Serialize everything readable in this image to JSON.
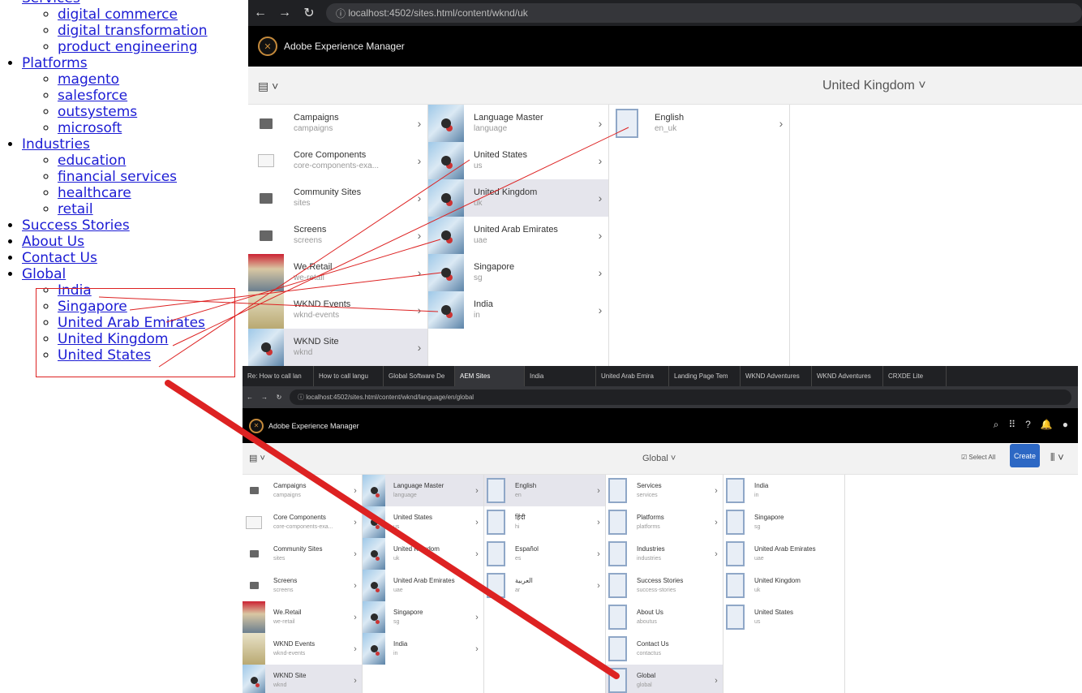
{
  "nav": {
    "items": [
      {
        "label": "Services",
        "children": [
          "digital commerce",
          "digital transformation",
          "product engineering"
        ]
      },
      {
        "label": "Platforms",
        "children": [
          "magento",
          "salesforce",
          "outsystems",
          "microsoft"
        ]
      },
      {
        "label": "Industries",
        "children": [
          "education",
          "financial services",
          "healthcare",
          "retail"
        ]
      },
      {
        "label": "Success Stories",
        "children": []
      },
      {
        "label": "About Us",
        "children": []
      },
      {
        "label": "Contact Us",
        "children": []
      },
      {
        "label": "Global",
        "children": [
          "India",
          "Singapore",
          "United Arab Emirates",
          "United Kingdom",
          "United States"
        ]
      }
    ]
  },
  "screen1": {
    "url": "localhost:4502/sites.html/content/wknd/uk",
    "app_title": "Adobe Experience Manager",
    "location_title": "United Kingdom",
    "columns": [
      [
        {
          "title": "Campaigns",
          "sub": "campaigns",
          "thumb": "folder"
        },
        {
          "title": "Core Components",
          "sub": "core-components-exa...",
          "thumb": "comp"
        },
        {
          "title": "Community Sites",
          "sub": "sites",
          "thumb": "folder"
        },
        {
          "title": "Screens",
          "sub": "screens",
          "thumb": "folder"
        },
        {
          "title": "We.Retail",
          "sub": "we-retail",
          "thumb": "photo"
        },
        {
          "title": "WKND Events",
          "sub": "wknd-events",
          "thumb": "photo2"
        },
        {
          "title": "WKND Site",
          "sub": "wknd",
          "thumb": "img",
          "selected": true
        }
      ],
      [
        {
          "title": "Language Master",
          "sub": "language",
          "thumb": "img"
        },
        {
          "title": "United States",
          "sub": "us",
          "thumb": "img"
        },
        {
          "title": "United Kingdom",
          "sub": "uk",
          "thumb": "img",
          "selected": true
        },
        {
          "title": "United Arab Emirates",
          "sub": "uae",
          "thumb": "img"
        },
        {
          "title": "Singapore",
          "sub": "sg",
          "thumb": "img"
        },
        {
          "title": "India",
          "sub": "in",
          "thumb": "img"
        }
      ],
      [
        {
          "title": "English",
          "sub": "en_uk",
          "thumb": "page"
        }
      ]
    ]
  },
  "screen2": {
    "tabs": [
      "Re: How to call lan",
      "How to call langu",
      "Global Software De",
      "AEM Sites",
      "India",
      "United Arab Emira",
      "Landing Page Tem",
      "WKND Adventures",
      "WKND Adventures",
      "CRXDE Lite"
    ],
    "url": "localhost:4502/sites.html/content/wknd/language/en/global",
    "app_title": "Adobe Experience Manager",
    "location_title": "Global",
    "select_all": "Select All",
    "create": "Create",
    "columns": [
      [
        {
          "title": "Campaigns",
          "sub": "campaigns",
          "thumb": "folder"
        },
        {
          "title": "Core Components",
          "sub": "core-components-exa...",
          "thumb": "comp"
        },
        {
          "title": "Community Sites",
          "sub": "sites",
          "thumb": "folder"
        },
        {
          "title": "Screens",
          "sub": "screens",
          "thumb": "folder"
        },
        {
          "title": "We.Retail",
          "sub": "we-retail",
          "thumb": "photo"
        },
        {
          "title": "WKND Events",
          "sub": "wknd-events",
          "thumb": "photo2"
        },
        {
          "title": "WKND Site",
          "sub": "wknd",
          "thumb": "img",
          "selected": true
        }
      ],
      [
        {
          "title": "Language Master",
          "sub": "language",
          "thumb": "img",
          "selected": true
        },
        {
          "title": "United States",
          "sub": "us",
          "thumb": "img"
        },
        {
          "title": "United Kingdom",
          "sub": "uk",
          "thumb": "img"
        },
        {
          "title": "United Arab Emirates",
          "sub": "uae",
          "thumb": "img"
        },
        {
          "title": "Singapore",
          "sub": "sg",
          "thumb": "img"
        },
        {
          "title": "India",
          "sub": "in",
          "thumb": "img"
        }
      ],
      [
        {
          "title": "English",
          "sub": "en",
          "thumb": "page",
          "selected": true
        },
        {
          "title": "हिंदी",
          "sub": "hi",
          "thumb": "page"
        },
        {
          "title": "Español",
          "sub": "es",
          "thumb": "page"
        },
        {
          "title": "العربية",
          "sub": "ar",
          "thumb": "page"
        }
      ],
      [
        {
          "title": "Services",
          "sub": "services",
          "thumb": "page"
        },
        {
          "title": "Platforms",
          "sub": "platforms",
          "thumb": "page"
        },
        {
          "title": "Industries",
          "sub": "industries",
          "thumb": "page"
        },
        {
          "title": "Success Stories",
          "sub": "success-stories",
          "thumb": "page",
          "nochev": true
        },
        {
          "title": "About Us",
          "sub": "aboutus",
          "thumb": "page",
          "nochev": true
        },
        {
          "title": "Contact Us",
          "sub": "contactus",
          "thumb": "page",
          "nochev": true
        },
        {
          "title": "Global",
          "sub": "global",
          "thumb": "page",
          "selected": true
        }
      ],
      [
        {
          "title": "India",
          "sub": "in",
          "thumb": "page",
          "nochev": true
        },
        {
          "title": "Singapore",
          "sub": "sg",
          "thumb": "page",
          "nochev": true
        },
        {
          "title": "United Arab Emirates",
          "sub": "uae",
          "thumb": "page",
          "nochev": true
        },
        {
          "title": "United Kingdom",
          "sub": "uk",
          "thumb": "page",
          "nochev": true
        },
        {
          "title": "United States",
          "sub": "us",
          "thumb": "page",
          "nochev": true
        }
      ]
    ]
  },
  "colors": {
    "annotation_red": "#dd2222",
    "link_blue": "#1c1cd4",
    "create_blue": "#2d68c4"
  }
}
